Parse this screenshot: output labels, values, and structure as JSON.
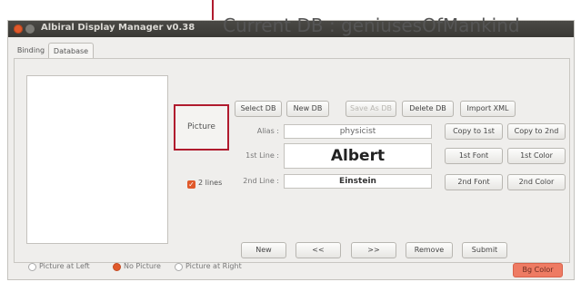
{
  "window": {
    "title": "Albiral Display Manager v0.38"
  },
  "tabs": [
    {
      "label": "Binding"
    },
    {
      "label": "Database"
    }
  ],
  "current_db_label": "Current DB : geniusesOfMankind",
  "db_buttons": {
    "select": "Select DB",
    "new": "New DB",
    "save_as": "Save As DB",
    "delete": "Delete DB",
    "import": "Import XML"
  },
  "picture_label": "Picture",
  "fields": {
    "alias": {
      "label": "Alias :",
      "value": "physicist"
    },
    "line1": {
      "label": "1st Line :",
      "value": "Albert"
    },
    "line2": {
      "label": "2nd Line :",
      "value": "Einstein"
    }
  },
  "side_buttons": {
    "copy_1st": "Copy to 1st",
    "copy_2nd": "Copy to 2nd",
    "font_1st": "1st Font",
    "color_1st": "1st Color",
    "font_2nd": "2nd Font",
    "color_2nd": "2nd Color"
  },
  "two_lines": {
    "label": "2 lines",
    "checked": true
  },
  "nav_buttons": {
    "new": "New",
    "prev": "<<",
    "next": ">>",
    "remove": "Remove",
    "submit": "Submit"
  },
  "picture_position": {
    "options": [
      "Picture at Left",
      "No Picture",
      "Picture at Right"
    ],
    "selected": "No Picture"
  },
  "bg_color_label": "Bg Color",
  "colors": {
    "accent": "#e0592b",
    "annotation": "#b01b2e",
    "bg_color_button": "#ee7b63"
  }
}
